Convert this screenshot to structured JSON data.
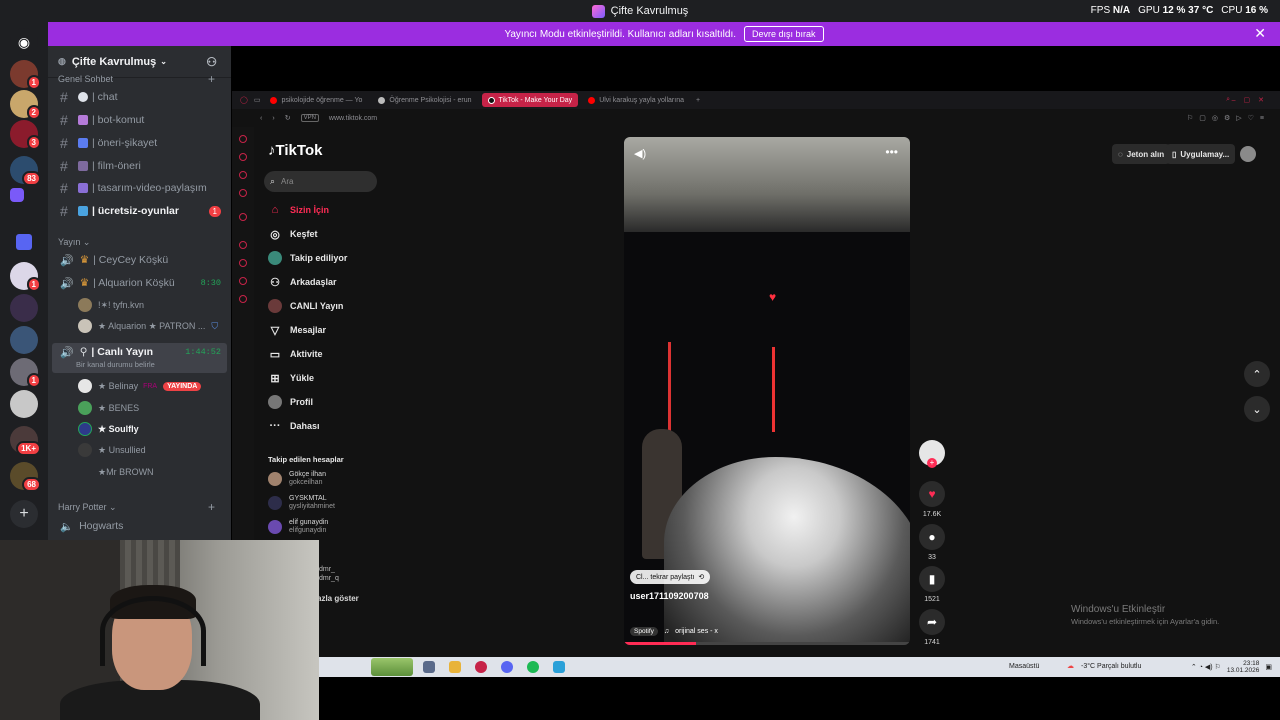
{
  "window": {
    "title": "Çifte Kavrulmuş",
    "stats": {
      "fps_label": "FPS",
      "fps_value": "N/A",
      "gpu_label": "GPU",
      "gpu_value": "12 % 37 °C",
      "cpu_label": "CPU",
      "cpu_value": "16 %"
    }
  },
  "banner": {
    "text": "Yayıncı Modu etkinleştirildi. Kullanıcı adları kısaltıldı.",
    "button": "Devre dışı bırak"
  },
  "server_rail": {
    "badges": [
      "1",
      "2",
      "3",
      "83",
      "1",
      "1",
      "1",
      "1K+",
      "68"
    ]
  },
  "sidebar": {
    "server_name": "Çifte Kavrulmuş",
    "category_top": "Genel Sohbet",
    "text_channels": [
      {
        "name": "| chat",
        "color": "#dfe3ea"
      },
      {
        "name": "| bot-komut",
        "color": "#b57bd9"
      },
      {
        "name": "| öneri-şikayet",
        "color": "#5b7cf0"
      },
      {
        "name": "| film-öneri",
        "color": "#7e6a9e"
      },
      {
        "name": "| tasarım-video-paylaşım",
        "color": "#8a6fd6"
      },
      {
        "name": "| ücretsiz-oyunlar",
        "color": "#4aa3e0",
        "mention": "1"
      }
    ],
    "voice_category": "Yayın",
    "voice_channels": [
      {
        "name": "| CeyCey Köşkü"
      },
      {
        "name": "| Alquarion Köşkü",
        "time": "8:30"
      }
    ],
    "alq_users": [
      "!✶! tyfn.kvn",
      "★ Alquarion ★ PATRON ..."
    ],
    "live_channel": {
      "name": "| Canlı Yayın",
      "time": "1:44:52",
      "status": "Bir kanal durumu belirle"
    },
    "live_users": [
      {
        "name": "★ Belinay",
        "extra": "FRA",
        "live": "YAYINDA"
      },
      {
        "name": "★ BENES"
      },
      {
        "name": "★ Soulfly"
      },
      {
        "name": "★ Unsullied"
      },
      {
        "name": "★Mr BROWN"
      }
    ],
    "bottom_category": "Harry Potter",
    "bottom_channel": "Hogwarts"
  },
  "browser": {
    "tabs": [
      "psikolojide öğrenme — Yo",
      "Öğrenme Psikolojisi - erun",
      "TikTok - Make Your Day",
      "Ulvi karakuş yayla yollarına"
    ],
    "url": "www.tiktok.com",
    "vpn": "VPN"
  },
  "tiktok": {
    "logo": "TikTok",
    "search_placeholder": "Ara",
    "nav": [
      {
        "label": "Sizin İçin",
        "icon": "home-icon"
      },
      {
        "label": "Keşfet",
        "icon": "compass-icon"
      },
      {
        "label": "Takip ediliyor",
        "icon": "following-icon"
      },
      {
        "label": "Arkadaşlar",
        "icon": "friends-icon"
      },
      {
        "label": "CANLI Yayın",
        "icon": "live-icon"
      },
      {
        "label": "Mesajlar",
        "icon": "messages-icon"
      },
      {
        "label": "Aktivite",
        "icon": "activity-icon"
      },
      {
        "label": "Yükle",
        "icon": "upload-icon"
      },
      {
        "label": "Profil",
        "icon": "profile-icon"
      },
      {
        "label": "Dahası",
        "icon": "more-icon"
      }
    ],
    "following_header": "Takip edilen hesaplar",
    "following": [
      {
        "name": "Gökçe ilhan",
        "handle": "gokceilhan"
      },
      {
        "name": "GYSKMTAL",
        "handle": "gysliyitahminet"
      },
      {
        "name": "elif gunaydin",
        "handle": "elifgunaydin"
      }
    ],
    "partial_account": [
      "dmr_",
      "dmr_q"
    ],
    "show_more": "azla göster",
    "top_right": {
      "coins": "Jeton alın",
      "app": "Uygulamay..."
    },
    "video": {
      "repost": "Cl... tekrar paylaştı",
      "username": "user171109200708",
      "music_tag": "Spotify",
      "sound": "orijinal ses - x",
      "progress": 0.25
    },
    "actions": [
      {
        "name": "like",
        "count": "17.6K"
      },
      {
        "name": "comment",
        "count": "33"
      },
      {
        "name": "bookmark",
        "count": "1521"
      },
      {
        "name": "share",
        "count": "1741"
      }
    ]
  },
  "windows_activation": {
    "title": "Windows'u Etkinleştir",
    "subtitle": "Windows'u etkinleştirmek için Ayarlar'a gidin."
  },
  "taskbar": {
    "desktop": "Masaüstü",
    "weather": "-3°C  Parçalı bulutlu",
    "time": "23:18",
    "date": "13.01.2026"
  }
}
